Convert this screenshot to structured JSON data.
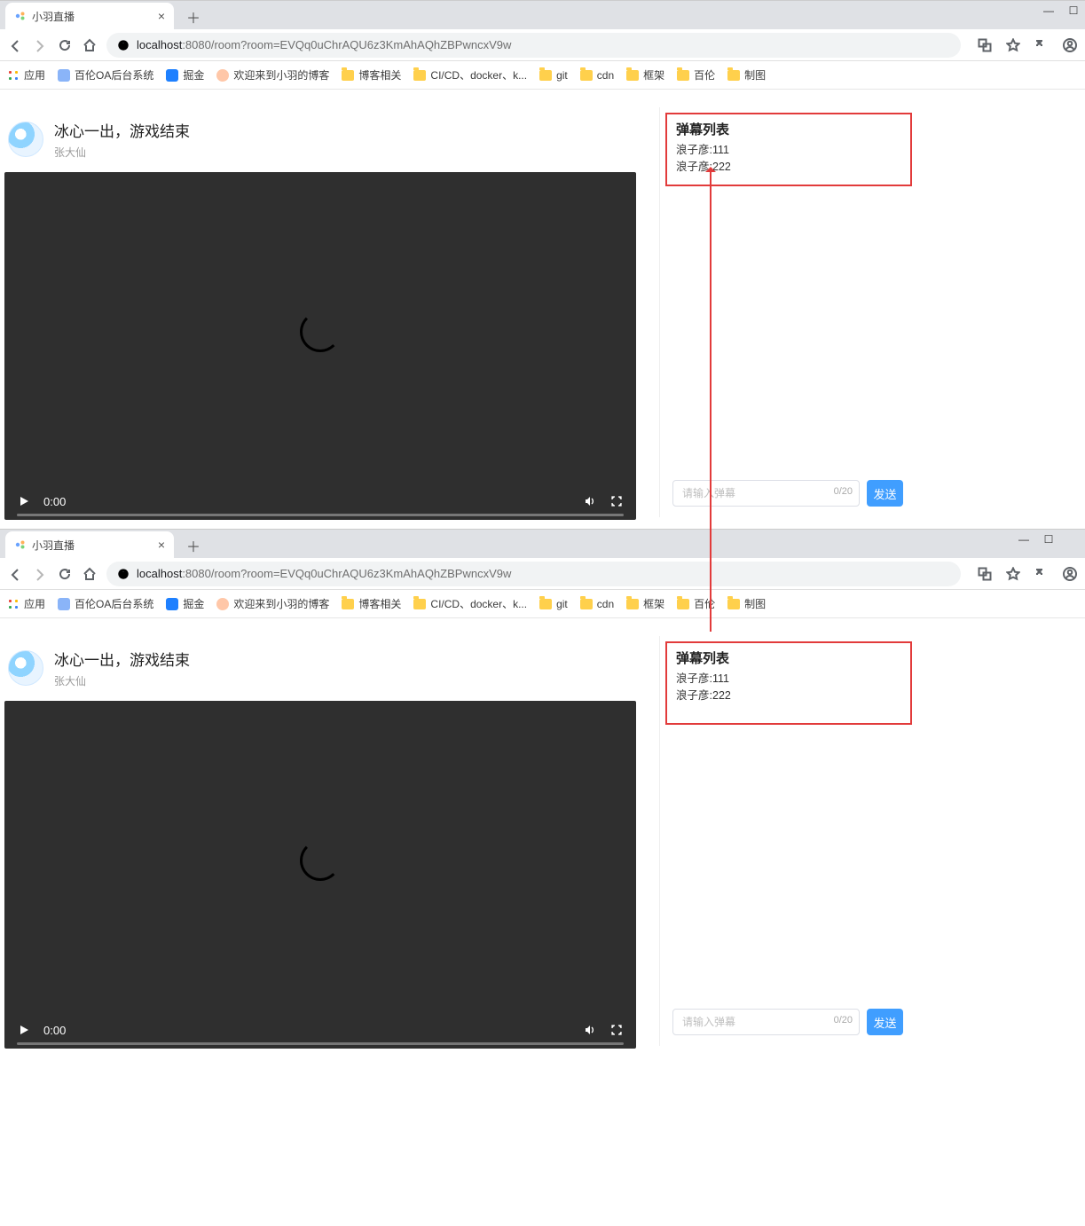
{
  "windows": [
    {
      "tab_title": "小羽直播",
      "url_host": "localhost",
      "url_port": ":8080",
      "url_path": "/room?room=EVQq0uChrAQU6z3KmAhAQhZBPwncxV9w",
      "bookmarks": {
        "apps": "应用",
        "items": [
          {
            "icon": "generic",
            "label": "百伦OA后台系统"
          },
          {
            "icon": "juejin",
            "label": "掘金"
          },
          {
            "icon": "avatar",
            "label": "欢迎来到小羽的博客"
          },
          {
            "icon": "folder",
            "label": "博客相关"
          },
          {
            "icon": "folder",
            "label": "CI/CD、docker、k..."
          },
          {
            "icon": "folder",
            "label": "git"
          },
          {
            "icon": "folder",
            "label": "cdn"
          },
          {
            "icon": "folder",
            "label": "框架"
          },
          {
            "icon": "folder",
            "label": "百伦"
          },
          {
            "icon": "folder",
            "label": "制图"
          }
        ]
      },
      "room": {
        "title": "冰心一出，游戏结束",
        "author": "张大仙",
        "video_time": "0:00"
      },
      "danmu": {
        "heading": "弹幕列表",
        "items": [
          {
            "user": "浪子彦",
            "text": ":111"
          },
          {
            "user": "浪子彦",
            "text": ":222"
          }
        ],
        "input_placeholder": "请输入弹幕",
        "counter": "0/20",
        "send_label": "发送",
        "panel_tall": false
      }
    },
    {
      "tab_title": "小羽直播",
      "url_host": "localhost",
      "url_port": ":8080",
      "url_path": "/room?room=EVQq0uChrAQU6z3KmAhAQhZBPwncxV9w",
      "bookmarks": {
        "apps": "应用",
        "items": [
          {
            "icon": "generic",
            "label": "百伦OA后台系统"
          },
          {
            "icon": "juejin",
            "label": "掘金"
          },
          {
            "icon": "avatar",
            "label": "欢迎来到小羽的博客"
          },
          {
            "icon": "folder",
            "label": "博客相关"
          },
          {
            "icon": "folder",
            "label": "CI/CD、docker、k..."
          },
          {
            "icon": "folder",
            "label": "git"
          },
          {
            "icon": "folder",
            "label": "cdn"
          },
          {
            "icon": "folder",
            "label": "框架"
          },
          {
            "icon": "folder",
            "label": "百伦"
          },
          {
            "icon": "folder",
            "label": "制图"
          }
        ]
      },
      "room": {
        "title": "冰心一出，游戏结束",
        "author": "张大仙",
        "video_time": "0:00"
      },
      "danmu": {
        "heading": "弹幕列表",
        "items": [
          {
            "user": "浪子彦",
            "text": ":111"
          },
          {
            "user": "浪子彦",
            "text": ":222"
          }
        ],
        "input_placeholder": "请输入弹幕",
        "counter": "0/20",
        "send_label": "发送",
        "panel_tall": true
      }
    }
  ]
}
